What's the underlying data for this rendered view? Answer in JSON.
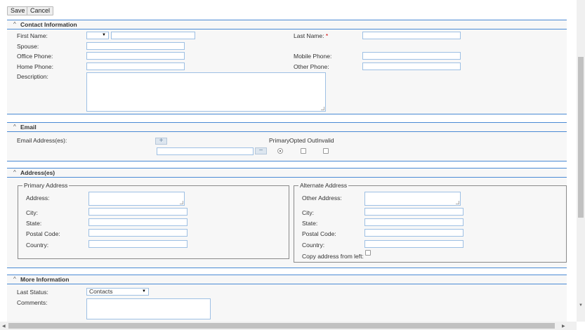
{
  "toolbar": {
    "save_label": "Save",
    "cancel_label": "Cancel"
  },
  "contact": {
    "title": "Contact Information",
    "first_name_label": "First Name:",
    "last_name_label": "Last Name:",
    "required_mark": "*",
    "spouse_label": "Spouse:",
    "office_phone_label": "Office Phone:",
    "mobile_phone_label": "Mobile Phone:",
    "home_phone_label": "Home Phone:",
    "other_phone_label": "Other Phone:",
    "description_label": "Description:",
    "salutation_value": ""
  },
  "email": {
    "title": "Email",
    "addresses_label": "Email Address(es):",
    "col_primary": "Primary",
    "col_opted_out": "Opted Out",
    "col_invalid": "Invalid",
    "add_symbol": "+",
    "remove_symbol": "−"
  },
  "addresses": {
    "title": "Address(es)",
    "primary": {
      "legend": "Primary Address",
      "address_label": "Address:",
      "city_label": "City:",
      "state_label": "State:",
      "postal_label": "Postal Code:",
      "country_label": "Country:"
    },
    "alternate": {
      "legend": "Alternate Address",
      "address_label": "Other Address:",
      "city_label": "City:",
      "state_label": "State:",
      "postal_label": "Postal Code:",
      "country_label": "Country:",
      "copy_label": "Copy address from left:"
    }
  },
  "more": {
    "title": "More Information",
    "last_status_label": "Last Status:",
    "last_status_value": "Contacts",
    "comments_label": "Comments:"
  },
  "icons": {
    "caret": "^",
    "dropdown": "▼"
  },
  "colors": {
    "accent": "#4a8ad4",
    "input_border": "#9ec0e4"
  }
}
